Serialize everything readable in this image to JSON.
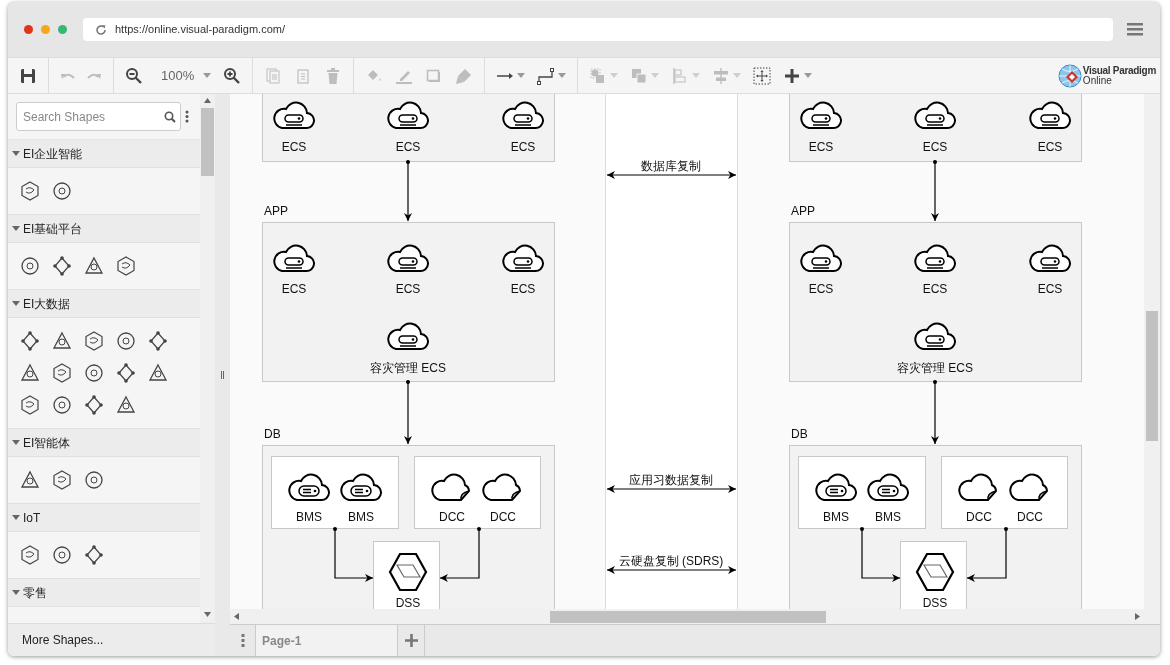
{
  "browser": {
    "url": "https://online.visual-paradigm.com/"
  },
  "toolbar": {
    "groups": [
      [
        {
          "kind": "save",
          "disabled": false
        }
      ],
      [
        {
          "kind": "undo",
          "disabled": true
        },
        {
          "kind": "redo",
          "disabled": true
        }
      ],
      [
        {
          "kind": "zoom-out",
          "disabled": false
        },
        {
          "kind": "zoom-level",
          "label": "100%",
          "disabled": false,
          "menu": true
        },
        {
          "kind": "zoom-in",
          "disabled": false
        }
      ],
      [
        {
          "kind": "copy",
          "disabled": true
        },
        {
          "kind": "paste",
          "disabled": true
        },
        {
          "kind": "delete",
          "disabled": true
        }
      ],
      [
        {
          "kind": "fill",
          "disabled": true
        },
        {
          "kind": "line",
          "disabled": true
        },
        {
          "kind": "shadow",
          "disabled": true
        },
        {
          "kind": "format",
          "disabled": true
        }
      ],
      [
        {
          "kind": "connector",
          "disabled": false,
          "menu": true
        },
        {
          "kind": "waypoint",
          "disabled": false,
          "menu": true
        }
      ],
      [
        {
          "kind": "to-front",
          "disabled": true,
          "menu": true
        },
        {
          "kind": "arrange",
          "disabled": true,
          "menu": true
        },
        {
          "kind": "align",
          "disabled": true,
          "menu": true
        },
        {
          "kind": "distribute",
          "disabled": true,
          "menu": true
        },
        {
          "kind": "select",
          "disabled": false
        },
        {
          "kind": "insert",
          "disabled": false,
          "menu": true
        }
      ]
    ]
  },
  "logo": {
    "name": "Visual Paradigm",
    "sub": "Online"
  },
  "sidebar": {
    "search": {
      "placeholder": "Search Shapes"
    },
    "categories": [
      {
        "title": "EI企业智能",
        "expanded": true
      },
      {
        "title": "EI基础平台",
        "expanded": true
      },
      {
        "title": "EI大数据",
        "expanded": true
      },
      {
        "title": "EI智能体",
        "expanded": true
      },
      {
        "title": "IoT",
        "expanded": true
      },
      {
        "title": "零售",
        "expanded": true
      }
    ],
    "more": "More Shapes..."
  },
  "page_tabs": [
    {
      "label": "Page-1",
      "selected": true
    }
  ],
  "sites": [
    {
      "groups": [
        {
          "nodes": [
            {
              "kind": "ecs",
              "label": "ECS"
            },
            {
              "kind": "ecs",
              "label": "ECS"
            },
            {
              "kind": "ecs",
              "label": "ECS"
            }
          ]
        },
        {
          "label": "APP",
          "nodes": [
            {
              "kind": "ecs",
              "label": "ECS"
            },
            {
              "kind": "ecs",
              "label": "ECS"
            },
            {
              "kind": "ecs",
              "label": "ECS"
            },
            {
              "kind": "ecs",
              "label": "容灾管理 ECS"
            }
          ]
        },
        {
          "label": "DB",
          "clusters": [
            {
              "nodes": [
                {
                  "kind": "bms",
                  "label": "BMS"
                },
                {
                  "kind": "bms",
                  "label": "BMS"
                }
              ]
            },
            {
              "nodes": [
                {
                  "kind": "dcc",
                  "label": "DCC"
                },
                {
                  "kind": "dcc",
                  "label": "DCC"
                }
              ]
            },
            {
              "nodes": [
                {
                  "kind": "dss",
                  "label": "DSS"
                }
              ]
            }
          ]
        }
      ]
    },
    {
      "groups": [
        {
          "nodes": [
            {
              "kind": "ecs",
              "label": "ECS"
            },
            {
              "kind": "ecs",
              "label": "ECS"
            },
            {
              "kind": "ecs",
              "label": "ECS"
            }
          ]
        },
        {
          "label": "APP",
          "nodes": [
            {
              "kind": "ecs",
              "label": "ECS"
            },
            {
              "kind": "ecs",
              "label": "ECS"
            },
            {
              "kind": "ecs",
              "label": "ECS"
            },
            {
              "kind": "ecs",
              "label": "容灾管理 ECS"
            }
          ]
        },
        {
          "label": "DB",
          "clusters": [
            {
              "nodes": [
                {
                  "kind": "bms",
                  "label": "BMS"
                },
                {
                  "kind": "bms",
                  "label": "BMS"
                }
              ]
            },
            {
              "nodes": [
                {
                  "kind": "dcc",
                  "label": "DCC"
                },
                {
                  "kind": "dcc",
                  "label": "DCC"
                }
              ]
            },
            {
              "nodes": [
                {
                  "kind": "dss",
                  "label": "DSS"
                }
              ]
            }
          ]
        }
      ]
    }
  ],
  "replications": [
    {
      "label": "数据库复制"
    },
    {
      "label": "应用习数据复制"
    },
    {
      "label": "云硬盘复制 (SDRS)"
    }
  ]
}
